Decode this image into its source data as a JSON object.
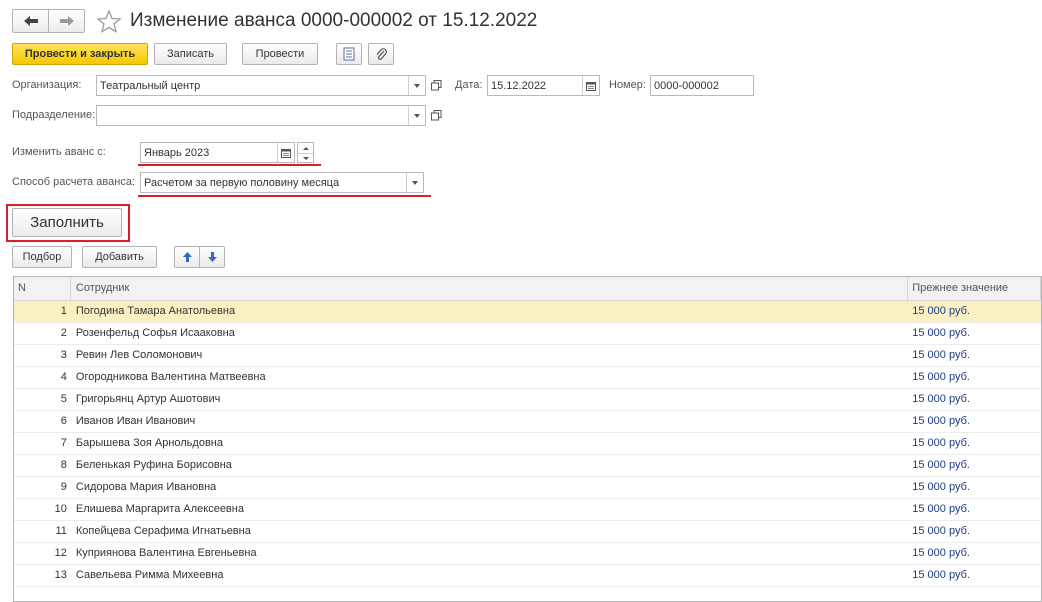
{
  "window": {
    "title": "Изменение аванса 0000-000002 от 15.12.2022"
  },
  "toolbar": {
    "post_and_close": "Провести и закрыть",
    "save": "Записать",
    "post": "Провести"
  },
  "form": {
    "organization_label": "Организация:",
    "organization_value": "Театральный центр",
    "date_label": "Дата:",
    "date_value": "15.12.2022",
    "number_label": "Номер:",
    "number_value": "0000-000002",
    "department_label": "Подразделение:",
    "department_value": "",
    "change_from_label": "Изменить аванс с:",
    "change_from_value": "Январь 2023",
    "method_label": "Способ расчета аванса:",
    "method_value": "Расчетом за первую половину месяца"
  },
  "actions": {
    "fill": "Заполнить",
    "pick": "Подбор",
    "add": "Добавить"
  },
  "table": {
    "columns": [
      "N",
      "Сотрудник",
      "Прежнее значение"
    ],
    "rows": [
      {
        "n": "1",
        "employee": "Погодина Тамара Анатольевна",
        "previous": "15 000 руб."
      },
      {
        "n": "2",
        "employee": "Розенфельд Софья Исааковна",
        "previous": "15 000 руб."
      },
      {
        "n": "3",
        "employee": "Ревин Лев Соломонович",
        "previous": "15 000 руб."
      },
      {
        "n": "4",
        "employee": "Огородникова Валентина Матвеевна",
        "previous": "15 000 руб."
      },
      {
        "n": "5",
        "employee": "Григорьянц Артур Ашотович",
        "previous": "15 000 руб."
      },
      {
        "n": "6",
        "employee": "Иванов Иван Иванович",
        "previous": "15 000 руб."
      },
      {
        "n": "7",
        "employee": "Барышева Зоя Арнольдовна",
        "previous": "15 000 руб."
      },
      {
        "n": "8",
        "employee": "Беленькая Руфина Борисовна",
        "previous": "15 000 руб."
      },
      {
        "n": "9",
        "employee": "Сидорова Мария Ивановна",
        "previous": "15 000 руб."
      },
      {
        "n": "10",
        "employee": "Елишева Маргарита Алексеевна",
        "previous": "15 000 руб."
      },
      {
        "n": "11",
        "employee": "Копейцева Серафима Игнатьевна",
        "previous": "15 000 руб."
      },
      {
        "n": "12",
        "employee": "Куприянова Валентина Евгеньевна",
        "previous": "15 000 руб."
      },
      {
        "n": "13",
        "employee": "Савельева Римма Михеевна",
        "previous": "15 000 руб."
      }
    ]
  },
  "colors": {
    "primary_button": "#f5c800",
    "highlight_red": "#d9202a",
    "selected_row": "#fbf0c2",
    "amount_text": "#1a3a8c"
  }
}
